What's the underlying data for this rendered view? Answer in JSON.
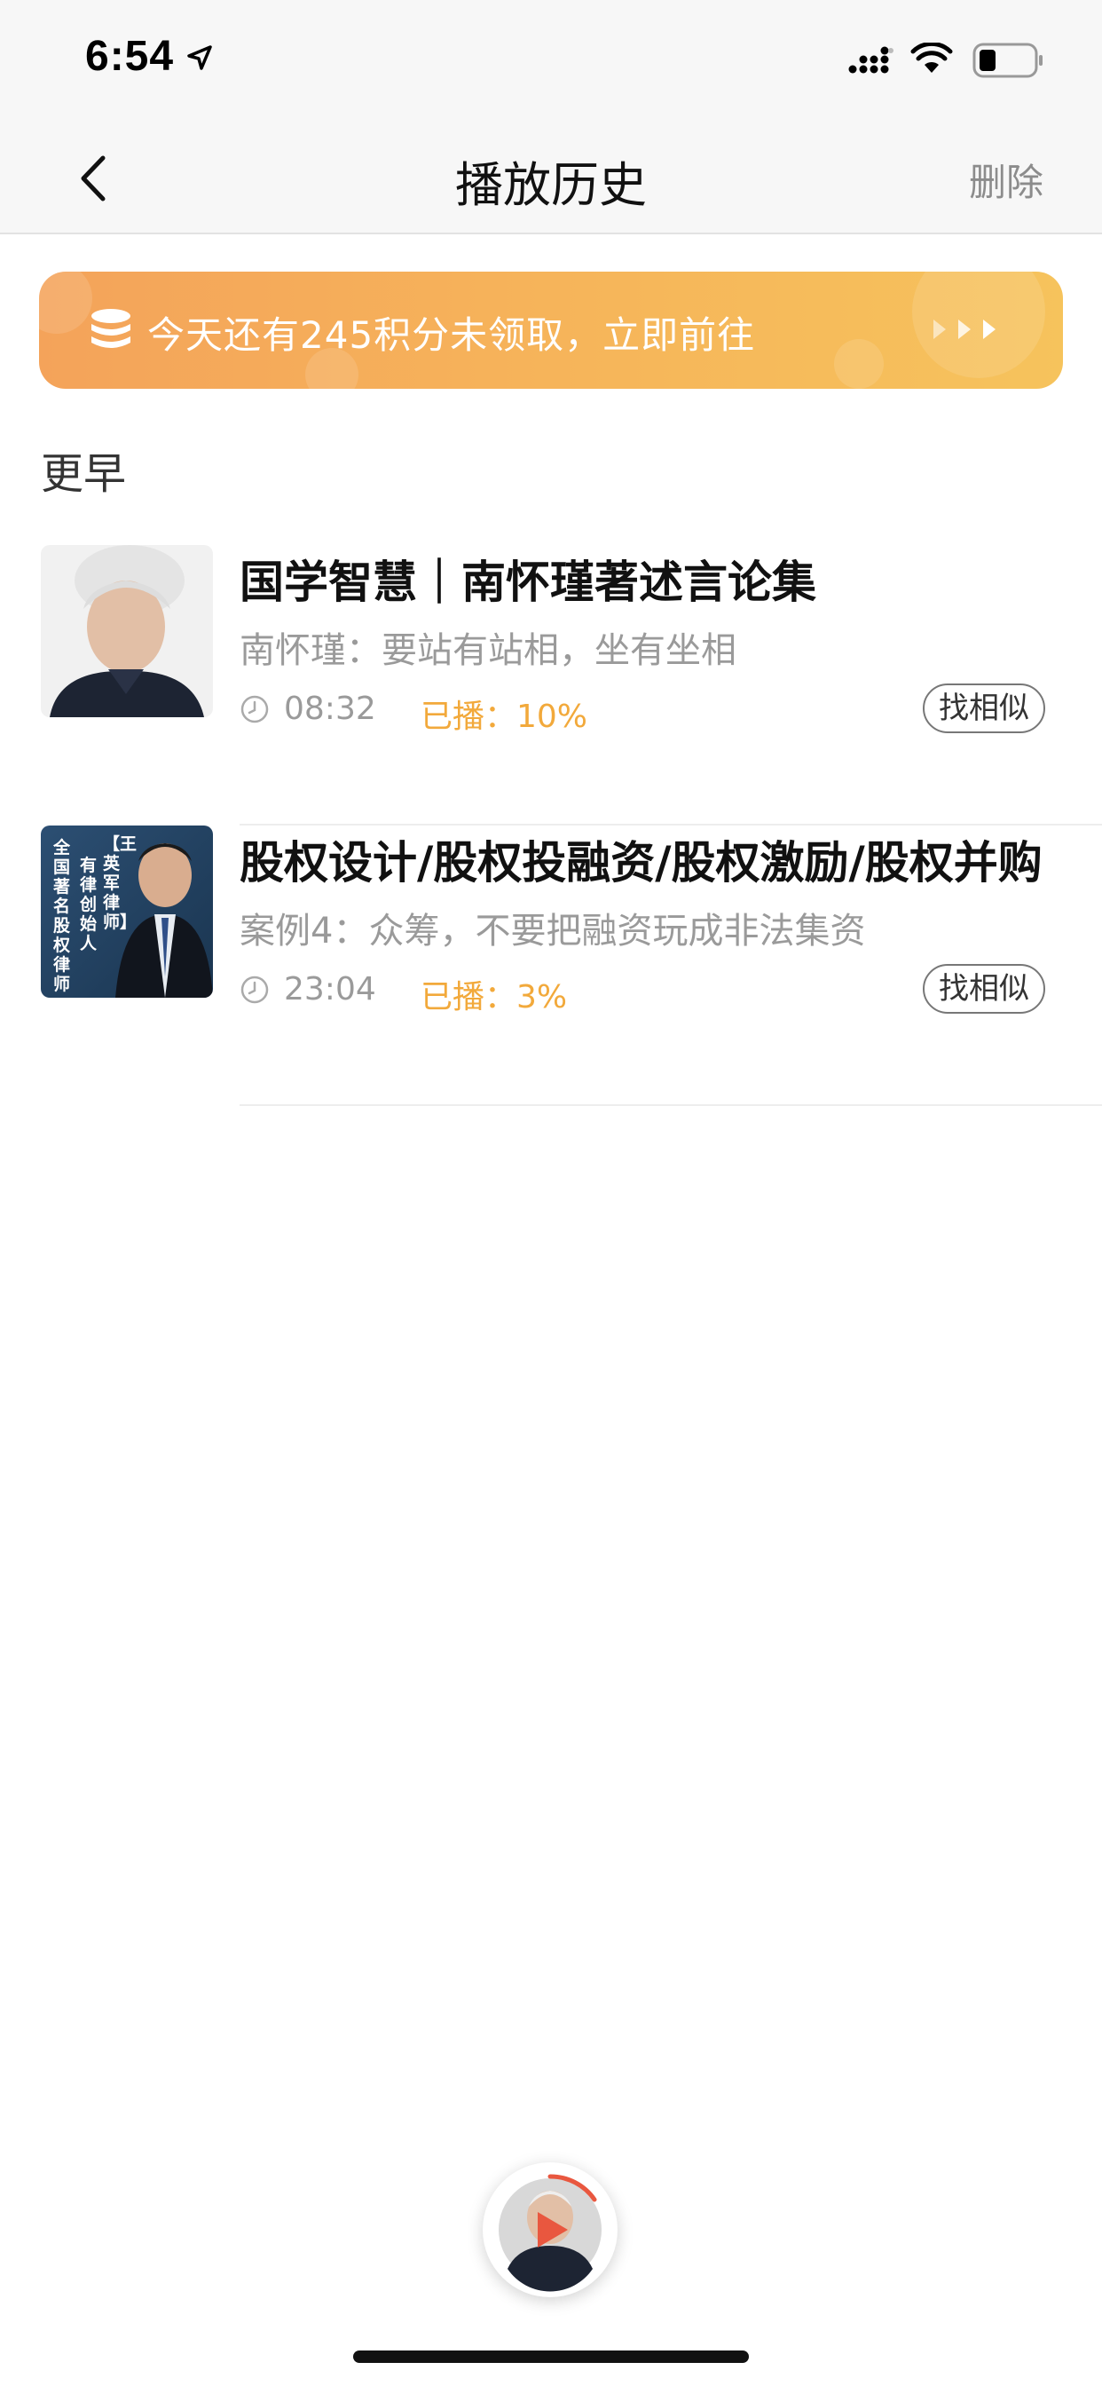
{
  "status_bar": {
    "time": "6:54"
  },
  "nav": {
    "title": "播放历史",
    "delete_label": "删除"
  },
  "banner": {
    "text": "今天还有245积分未领取，立即前往"
  },
  "section": {
    "title": "更早"
  },
  "items": [
    {
      "title": "国学智慧｜南怀瑾著述言论集",
      "subtitle": "南怀瑾：要站有站相，坐有坐相",
      "duration": "08:32",
      "progress_text": "已播：10%",
      "progress": 0.1,
      "similar_label": "找相似"
    },
    {
      "title": "股权设计/股权投融资/股权激励/股权并购",
      "subtitle": "案例4：众筹，不要把融资玩成非法集资",
      "duration": "23:04",
      "progress_text": "已播：3%",
      "progress": 0.03,
      "similar_label": "找相似",
      "thumb_text": {
        "right_col": "【王英军律师】",
        "mid_col": "有律 创始人",
        "left_col": "全国著名股权律师"
      }
    }
  ],
  "colors": {
    "accent_orange": "#f2a93b",
    "banner_start": "#f4a35a",
    "banner_end": "#f6c35c"
  },
  "icons": [
    "location-arrow-icon",
    "signal-icon",
    "wifi-icon",
    "battery-icon",
    "back-chevron-icon",
    "coins-icon",
    "arrows-icon",
    "clock-icon",
    "play-icon"
  ]
}
